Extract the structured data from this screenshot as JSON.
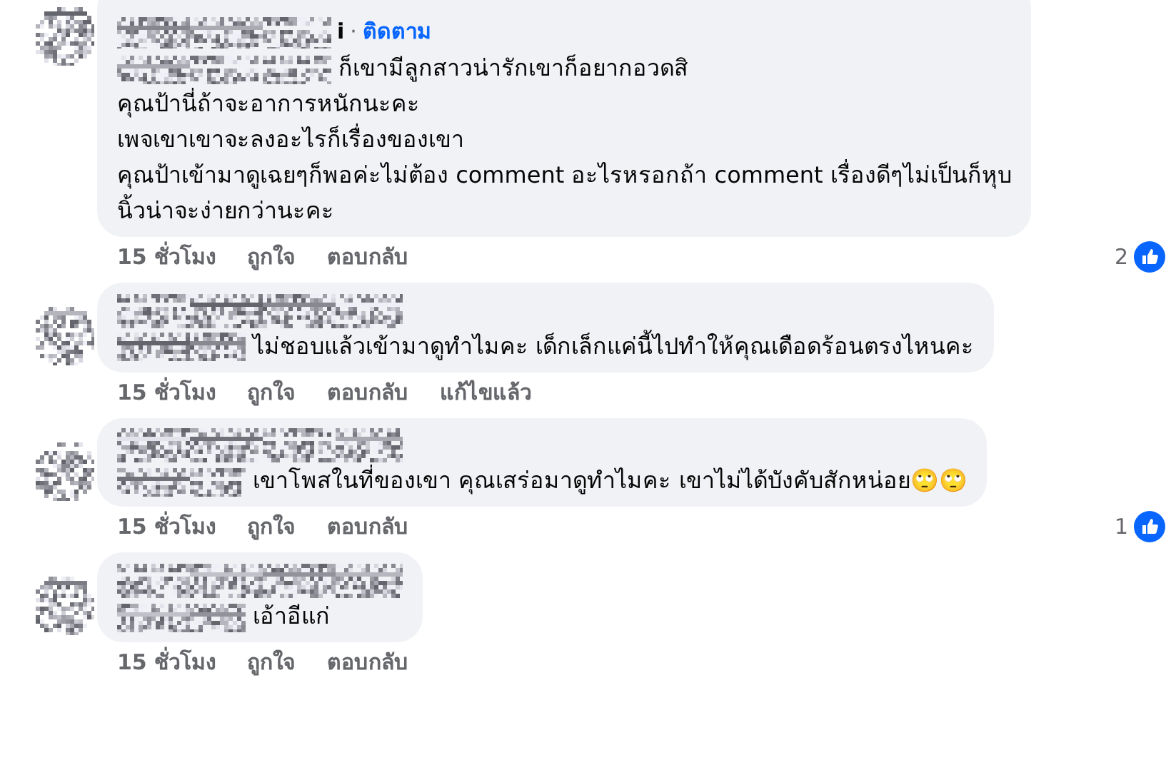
{
  "comments": [
    {
      "header": {
        "name_fragment": "i",
        "separator": "·",
        "follow": "ติดตาม"
      },
      "lines": [
        "ก็เขามีลูกสาวน่ารักเขาก็อยากอวดสิ",
        "คุณป้านี่ถ้าจะอาการหนักนะคะ",
        "เพจเขาเขาจะลงอะไรก็เรื่องของเขา",
        "คุณป้าเข้ามาดูเฉยๆก็พอค่ะไม่ต้อง comment อะไรหรอกถ้า comment เรื่องดีๆไม่เป็นก็หุบ",
        "นิ้วน่าจะง่ายกว่านะคะ"
      ],
      "time": "15 ชั่วโมง",
      "actions": [
        "ถูกใจ",
        "ตอบกลับ"
      ],
      "likes": "2"
    },
    {
      "lines": [
        "ไม่ชอบแล้วเข้ามาดูทำไมคะ เด็กเล็กแค่นี้ไปทำให้คุณเดือดร้อนตรงไหนคะ"
      ],
      "time": "15 ชั่วโมง",
      "actions": [
        "ถูกใจ",
        "ตอบกลับ"
      ],
      "edited": "แก้ไขแล้ว"
    },
    {
      "lines": [
        "เขาโพสในที่ของเขา คุณเสร่อมาดูทำไมคะ เขาไม่ได้บังคับสักหน่อย🙄🙄"
      ],
      "time": "15 ชั่วโมง",
      "actions": [
        "ถูกใจ",
        "ตอบกลับ"
      ],
      "likes": "1"
    },
    {
      "lines": [
        "เอ้าอีแก่"
      ],
      "time": "15 ชั่วโมง",
      "actions": [
        "ถูกใจ",
        "ตอบกลับ"
      ]
    }
  ]
}
